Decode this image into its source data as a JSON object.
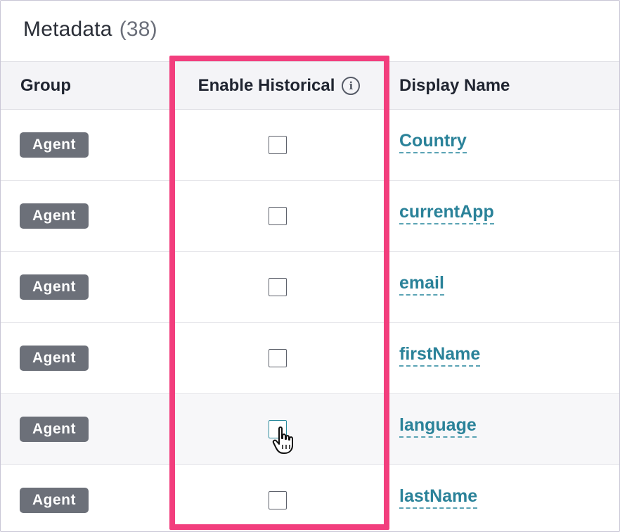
{
  "title": {
    "label": "Metadata",
    "count": "(38)"
  },
  "columns": {
    "group": "Group",
    "enable_historical": "Enable Historical",
    "display_name": "Display Name"
  },
  "icons": {
    "info": "info-icon",
    "cursor": "hand-pointer-icon"
  },
  "colors": {
    "highlight": "#f23e7d",
    "link": "#2a8299",
    "badge": "#6c7079"
  },
  "rows": [
    {
      "group": "Agent",
      "enable_historical": false,
      "display_name": "Country"
    },
    {
      "group": "Agent",
      "enable_historical": false,
      "display_name": "currentApp"
    },
    {
      "group": "Agent",
      "enable_historical": false,
      "display_name": "email"
    },
    {
      "group": "Agent",
      "enable_historical": false,
      "display_name": "firstName"
    },
    {
      "group": "Agent",
      "enable_historical": false,
      "display_name": "language"
    },
    {
      "group": "Agent",
      "enable_historical": false,
      "display_name": "lastName"
    }
  ]
}
